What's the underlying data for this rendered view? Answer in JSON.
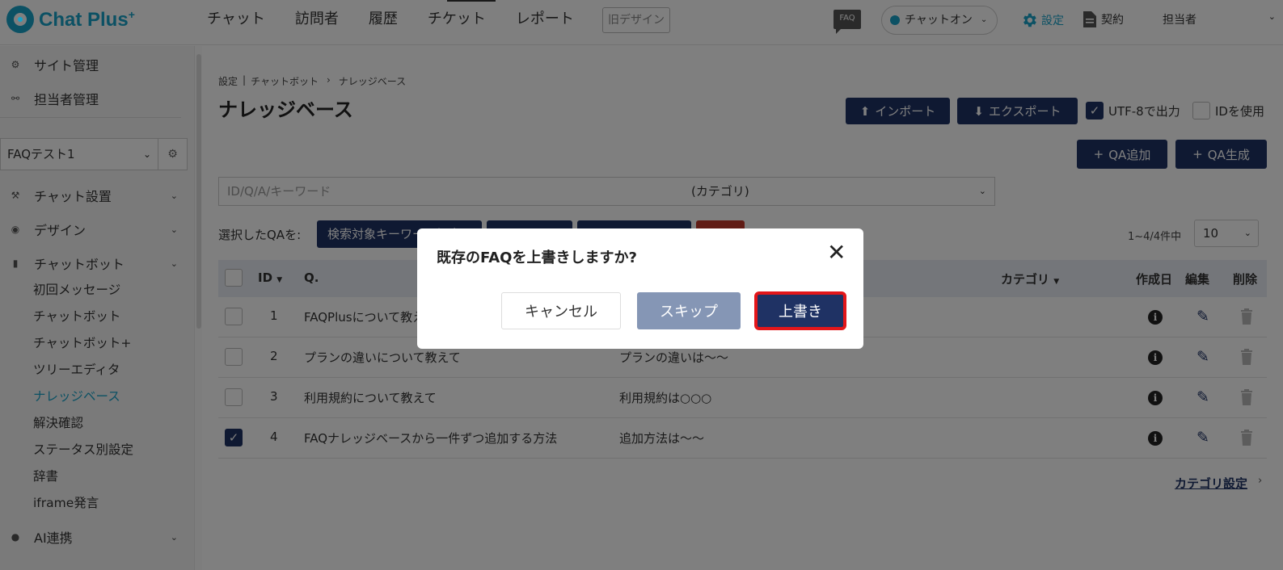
{
  "header": {
    "logo_text": "Chat Plus",
    "logo_sup": "+",
    "nav": [
      "チャット",
      "訪問者",
      "履歴",
      "チケット",
      "レポート"
    ],
    "old_design": "旧デザイン",
    "faq_badge": "FAQ",
    "chat_status": "チャットオン",
    "settings": "設定",
    "contract": "契約",
    "staff": "担当者"
  },
  "sidebar": {
    "site_admin": "サイト管理",
    "staff_admin": "担当者管理",
    "faq_select": "FAQテスト1",
    "groups": {
      "chat_setup": "チャット設置",
      "design": "デザイン",
      "chatbot": "チャットボット",
      "ai": "AI連携"
    },
    "sub_items": [
      "初回メッセージ",
      "チャットボット",
      "チャットボット+",
      "ツリーエディタ",
      "ナレッジベース",
      "解決確認",
      "ステータス別設定",
      "辞書",
      "iframe発言"
    ]
  },
  "main": {
    "breadcrumb": [
      "設定",
      "|",
      "チャットボット",
      "›",
      "ナレッジベース"
    ],
    "title": "ナレッジベース",
    "import": "インポート",
    "export": "エクスポート",
    "utf8": "UTF-8で出力",
    "use_id": "IDを使用",
    "qa_add": "QA追加",
    "qa_generate": "QA生成",
    "search_placeholder": "ID/Q/A/キーワード",
    "category_placeholder": "(カテゴリ)",
    "bulk_label": "選択したQAを:",
    "bulk_keyword": "検索対象キーワード設定",
    "count": "1~4/4件中",
    "per_page": "10",
    "columns": {
      "id": "ID",
      "q": "Q.",
      "category": "カテゴリ",
      "created": "作成日",
      "edit": "編集",
      "delete": "削除"
    },
    "rows": [
      {
        "id": "1",
        "q": "FAQPlusについて教えて",
        "a": "",
        "checked": false
      },
      {
        "id": "2",
        "q": "プランの違いについて教えて",
        "a": "プランの違いは～～",
        "checked": false
      },
      {
        "id": "3",
        "q": "利用規約について教えて",
        "a": "利用規約は○○○",
        "checked": false
      },
      {
        "id": "4",
        "q": "FAQナレッジベースから一件ずつ追加する方法",
        "a": "追加方法は～～",
        "checked": true
      }
    ],
    "category_settings": "カテゴリ設定"
  },
  "modal": {
    "title": "既存のFAQを上書きしますか?",
    "cancel": "キャンセル",
    "skip": "スキップ",
    "overwrite": "上書き"
  },
  "colors": {
    "brand": "#19a3c9",
    "navy": "#1f3264",
    "highlight": "#e3161a"
  }
}
